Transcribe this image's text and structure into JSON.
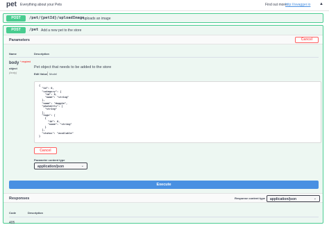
{
  "tag": {
    "name": "pet",
    "description": "Everything about your Pets",
    "external_label": "Find out more:",
    "external_link": "http://swagger.io",
    "toggle_icon": "chevron-up-icon"
  },
  "operations": [
    {
      "method": "POST",
      "path": "/pet/{petId}/uploadImage",
      "summary": "uploads an image"
    },
    {
      "method": "POST",
      "path": "/pet",
      "summary": "Add a new pet to the store"
    }
  ],
  "parameters": {
    "title": "Parameters",
    "cancel_label": "Cancel",
    "col_name": "Name",
    "col_description": "Description",
    "param": {
      "name": "body",
      "required": "* required",
      "type": "object",
      "in": "(body)",
      "description": "Pet object that needs to be added to the store",
      "tab_example": "Edit Value",
      "tab_model": "Model",
      "example_json": "{\n  \"id\": 0,\n  \"category\": {\n    \"id\": 0,\n    \"name\": \"string\"\n  },\n  \"name\": \"doggie\",\n  \"photoUrls\": [\n    \"string\"\n  ],\n  \"tags\": [\n    {\n      \"id\": 0,\n      \"name\": \"string\"\n    }\n  ],\n  \"status\": \"available\"\n}"
    },
    "cancel_bottom_label": "Cancel",
    "content_type_label": "Parameter content type",
    "content_type_value": "application/json"
  },
  "execute_label": "Execute",
  "responses": {
    "title": "Responses",
    "content_type_label": "Response content type",
    "content_type_value": "application/json",
    "col_code": "Code",
    "col_description": "Description",
    "rows": [
      {
        "code": "405"
      }
    ]
  },
  "colors": {
    "post": "#49cc90",
    "post_bg": "#edf7f2",
    "execute": "#4990e2",
    "cancel": "#ff6060"
  }
}
